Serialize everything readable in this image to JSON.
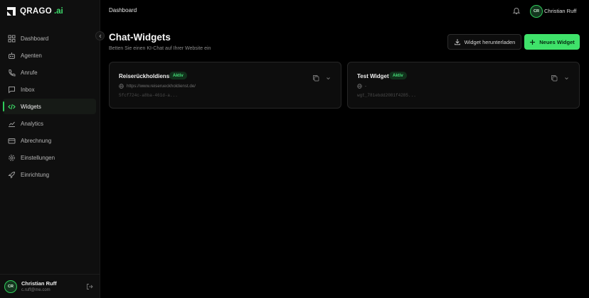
{
  "brand": {
    "name": "QRAGO",
    "suffix": ".ai"
  },
  "sidebar": {
    "items": [
      {
        "label": "Dashboard",
        "icon": "layout-grid-icon",
        "active": false
      },
      {
        "label": "Agenten",
        "icon": "bot-icon",
        "active": false
      },
      {
        "label": "Anrufe",
        "icon": "phone-icon",
        "active": false
      },
      {
        "label": "Inbox",
        "icon": "message-square-icon",
        "active": false
      },
      {
        "label": "Widgets",
        "icon": "code-icon",
        "active": true
      },
      {
        "label": "Analytics",
        "icon": "line-chart-icon",
        "active": false
      },
      {
        "label": "Abrechnung",
        "icon": "credit-card-icon",
        "active": false
      },
      {
        "label": "Einstellungen",
        "icon": "gear-icon",
        "active": false
      },
      {
        "label": "Einrichtung",
        "icon": "rocket-icon",
        "active": false
      }
    ],
    "user": {
      "initials": "CR",
      "name": "Christian Ruff",
      "email": "c.ruff@me.com"
    }
  },
  "topbar": {
    "crumb": "Dashboard",
    "user": {
      "initials": "CR",
      "name": "Christian Ruff"
    }
  },
  "page": {
    "title": "Chat-Widgets",
    "subtitle": "Betten Sie einen KI-Chat auf Ihrer Website ein",
    "download_label": "Widget herunterladen",
    "new_label": "Neues Widget"
  },
  "widgets": [
    {
      "name": "Reiserückholdienst",
      "status": "Aktiv",
      "url": "https://www.reiserueckholdienst.de/",
      "id": "5fcf724c-a8ba-461d-a..."
    },
    {
      "name": "Test Widget",
      "status": "Aktiv",
      "url": "-",
      "id": "wgt_781ebdd2081f4285..."
    }
  ],
  "colors": {
    "accent": "#3fe26a",
    "background": "#000000",
    "sidebar": "#0f0f0f",
    "card": "#0d0d0d"
  }
}
